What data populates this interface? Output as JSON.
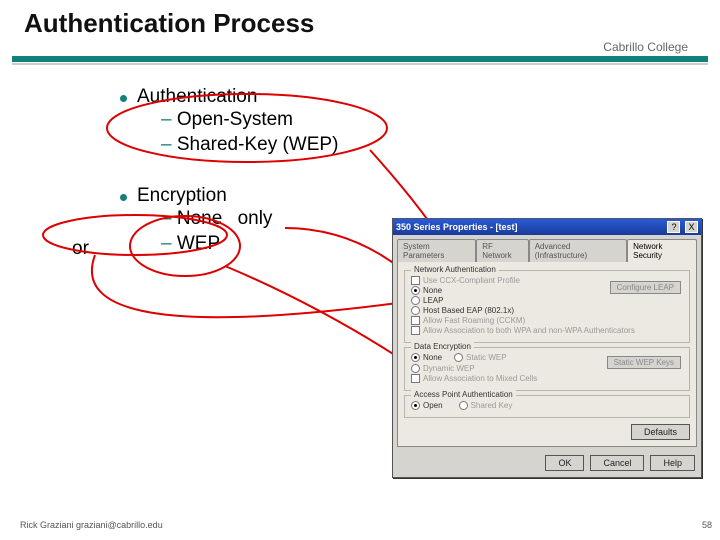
{
  "slide": {
    "title": "Authentication Process",
    "college": "Cabrillo College",
    "bullets": {
      "b1": {
        "title": "Authentication",
        "items": [
          "Open-System",
          "Shared-Key (WEP)"
        ]
      },
      "b2": {
        "title": "Encryption",
        "items": [
          "None",
          "WEP"
        ],
        "only_label": "only",
        "or_label": "or"
      }
    },
    "footer": "Rick Graziani  graziani@cabrillo.edu",
    "page": "58"
  },
  "dialog": {
    "title": "350 Series Properties - [test]",
    "close_btn": "X",
    "help_btn": "?",
    "tabs": [
      "System Parameters",
      "RF Network",
      "Advanced (Infrastructure)",
      "Network Security"
    ],
    "active_tab": 3,
    "groups": {
      "net_auth": {
        "title": "Network Authentication",
        "use_ccx": "Use CCX-Compliant Profile",
        "opts": [
          "None",
          "LEAP",
          "Host Based EAP (802.1x)"
        ],
        "selected": 0,
        "allow_fast": "Allow Fast Roaming (CCKM)",
        "allow_assoc_both": "Allow Association to both WPA and non-WPA Authenticators",
        "btn": "Configure LEAP"
      },
      "data_enc": {
        "title": "Data Encryption",
        "opts": [
          "None",
          "Static WEP",
          "Dynamic WEP"
        ],
        "selected": 0,
        "allow_mixed": "Allow Association to Mixed Cells",
        "btn": "Static WEP Keys"
      },
      "ap_auth": {
        "title": "Access Point Authentication",
        "opts": [
          "Open",
          "Shared Key"
        ],
        "selected": 0
      }
    },
    "buttons": {
      "defaults": "Defaults",
      "ok": "OK",
      "cancel": "Cancel",
      "help": "Help"
    }
  }
}
